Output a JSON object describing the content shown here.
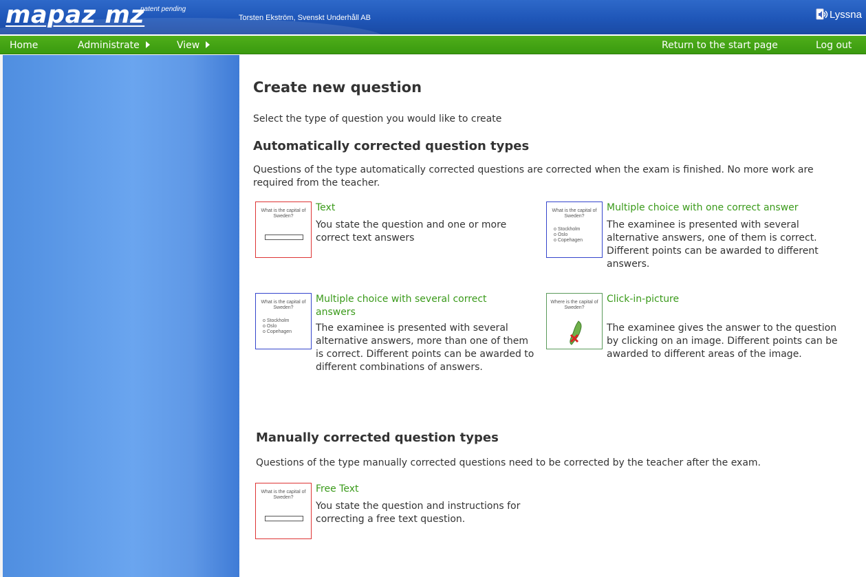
{
  "header": {
    "logo": "mapaz mz",
    "patent": "patent pending",
    "user": "Torsten Ekström, Svenskt Underhåll AB",
    "listen_label": "Lyssna"
  },
  "nav": {
    "home": "Home",
    "administrate": "Administrate",
    "view": "View",
    "return_start": "Return to the start page",
    "logout": "Log out"
  },
  "main": {
    "title": "Create new question",
    "intro": "Select the type of question you would like to create",
    "auto_section": {
      "title": "Automatically corrected question types",
      "desc": "Questions of the type automatically corrected questions are corrected when the exam is finished. No more work are required from the teacher."
    },
    "manual_section": {
      "title": "Manually corrected question types",
      "desc": "Questions of the type manually corrected questions need to be corrected by the teacher after the exam."
    },
    "types": {
      "text": {
        "name": "Text",
        "desc": "You state the question and one or more correct text answers",
        "thumb_question": "What is the capital of Sweden?"
      },
      "mc_one": {
        "name": "Multiple choice with one correct answer",
        "desc": "The examinee is presented with several alternative answers, one of them is correct. Different points can be awarded to different answers.",
        "thumb_question": "What is the capital of Sweden?",
        "thumb_options": [
          "o Stockholm",
          "o Oslo",
          "o Copehagen"
        ]
      },
      "mc_several": {
        "name": "Multiple choice with several correct answers",
        "desc": "The examinee is presented with several alternative answers, more than one of them is correct. Different points can be awarded to different combinations of answers.",
        "thumb_question": "What is the capital of Sweden?",
        "thumb_options": [
          "o Stockholm",
          "o Oslo",
          "o Copehagen"
        ]
      },
      "click": {
        "name": "Click-in-picture",
        "desc": "The examinee gives the answer to the question by clicking on an image. Different points can be awarded to different areas of the image.",
        "thumb_question": "Where is the capital of Sweden?"
      },
      "free": {
        "name": "Free Text",
        "desc": "You state the question and instructions for correcting a free text question.",
        "thumb_question": "What is the capital of Sweden?"
      }
    }
  }
}
